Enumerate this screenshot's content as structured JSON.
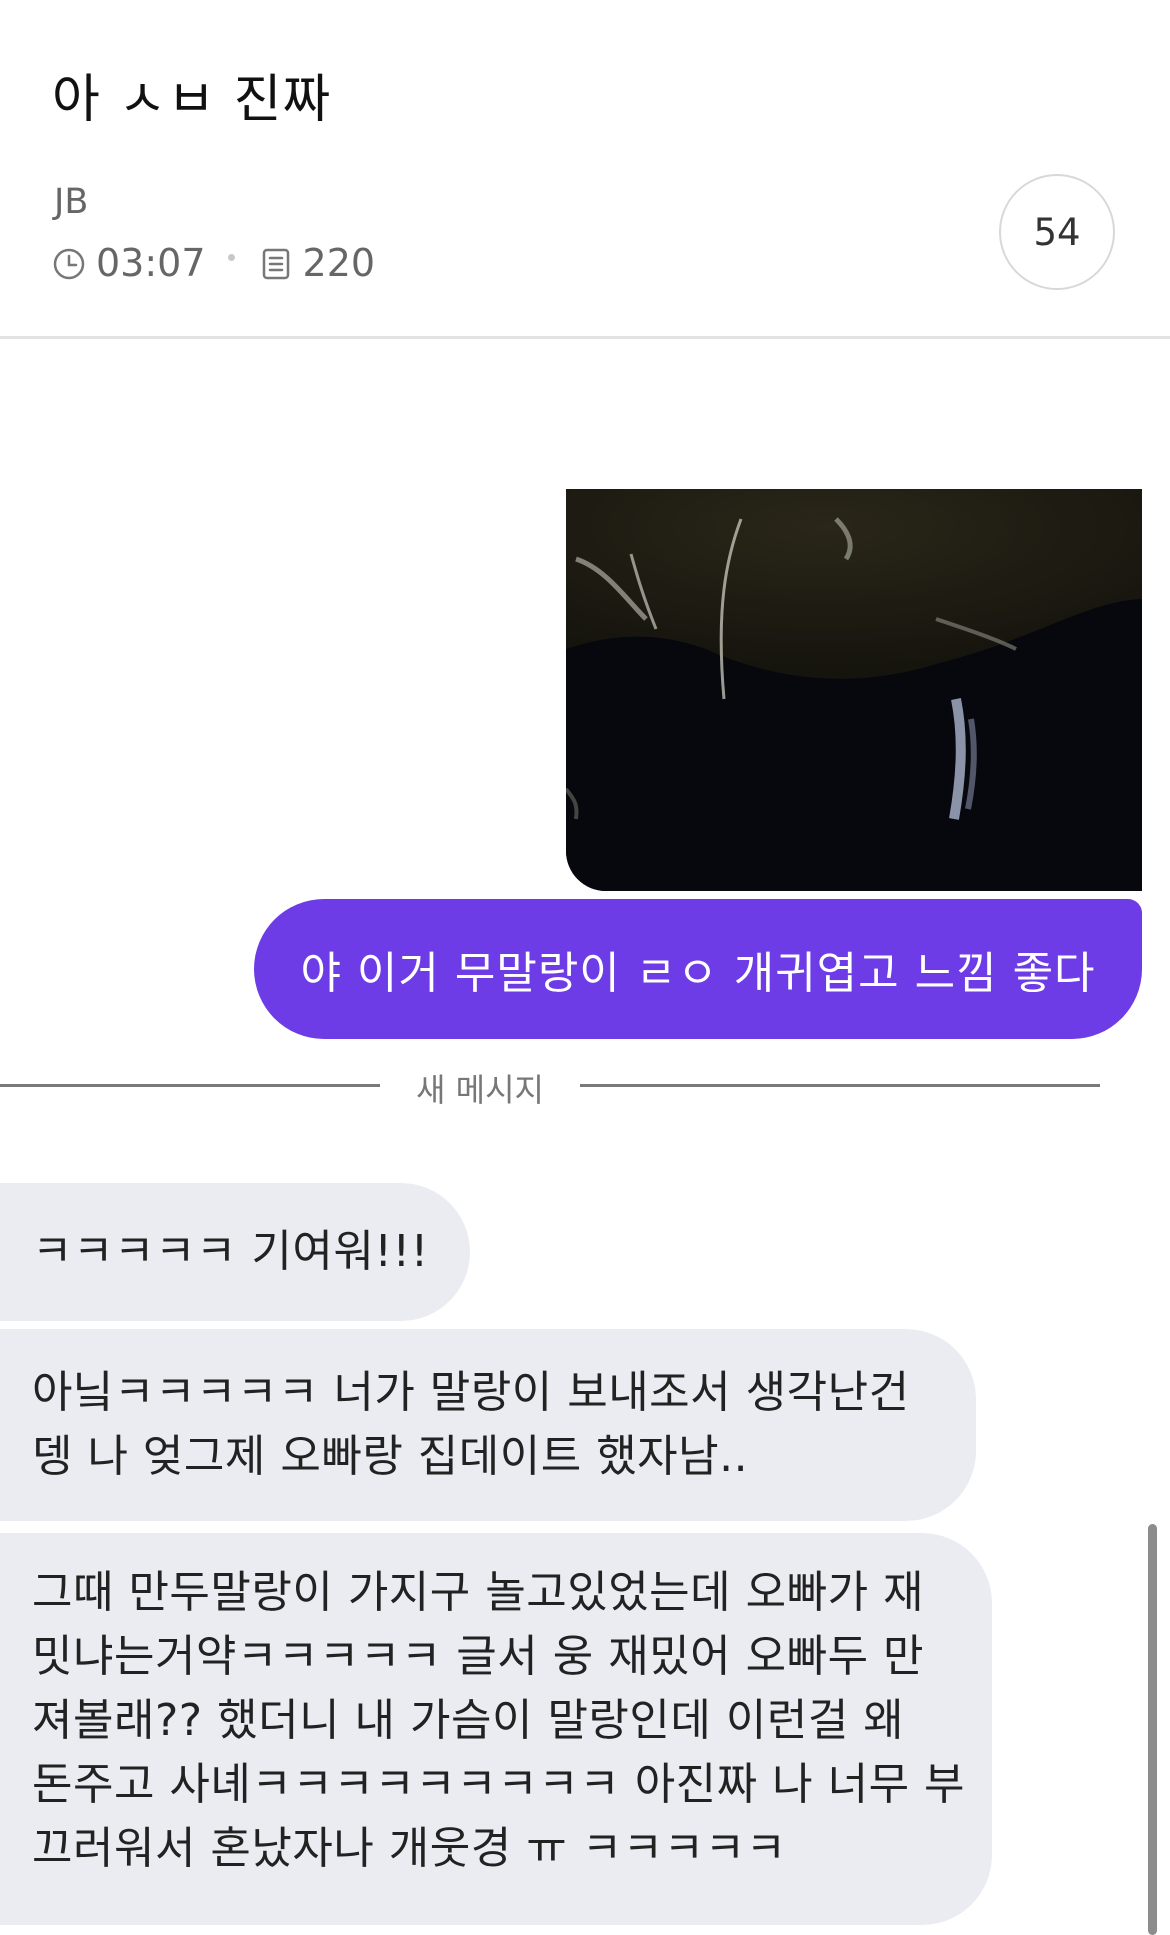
{
  "post": {
    "title": "아 ㅅㅂ 진짜",
    "author": "JB",
    "time": "03:07",
    "views": "220",
    "comment_count": "54"
  },
  "chat": {
    "sent_message": "야 이거 무말랑이 ㄹㅇ 개귀엽고 느낌 좋다",
    "divider_label": "새 메시지",
    "received": [
      {
        "lines": [
          "ㅋㅋㅋㅋㅋ 기여워!!!"
        ]
      },
      {
        "lines": [
          "아닠ㅋㅋㅋㅋㅋ 너가 말랑이 보내조서 생각난건",
          "뎅 나 엊그제 오빠랑 집데이트 했자남.."
        ]
      },
      {
        "lines": [
          "그때 만두말랑이 가지구 놀고있었는데 오빠가 재",
          "밋냐는거약ㅋㅋㅋㅋㅋ 글서 웅 재밌어 오빠두 만",
          "져볼래?? 했더니 내 가슴이 말랑인데 이런걸 왜",
          "돈주고 사녜ㅋㅋㅋㅋㅋㅋㅋㅋㅋ 아진짜 나 너무 부",
          "끄러워서 혼났자나 개웃경 ㅠ ㅋㅋㅋㅋㅋ"
        ]
      }
    ]
  },
  "icons": {
    "time": "clock-icon",
    "views": "document-icon"
  },
  "colors": {
    "sent_bubble": "#6e3ce6",
    "received_bubble": "#ebecf2",
    "meta_text": "#666666"
  }
}
